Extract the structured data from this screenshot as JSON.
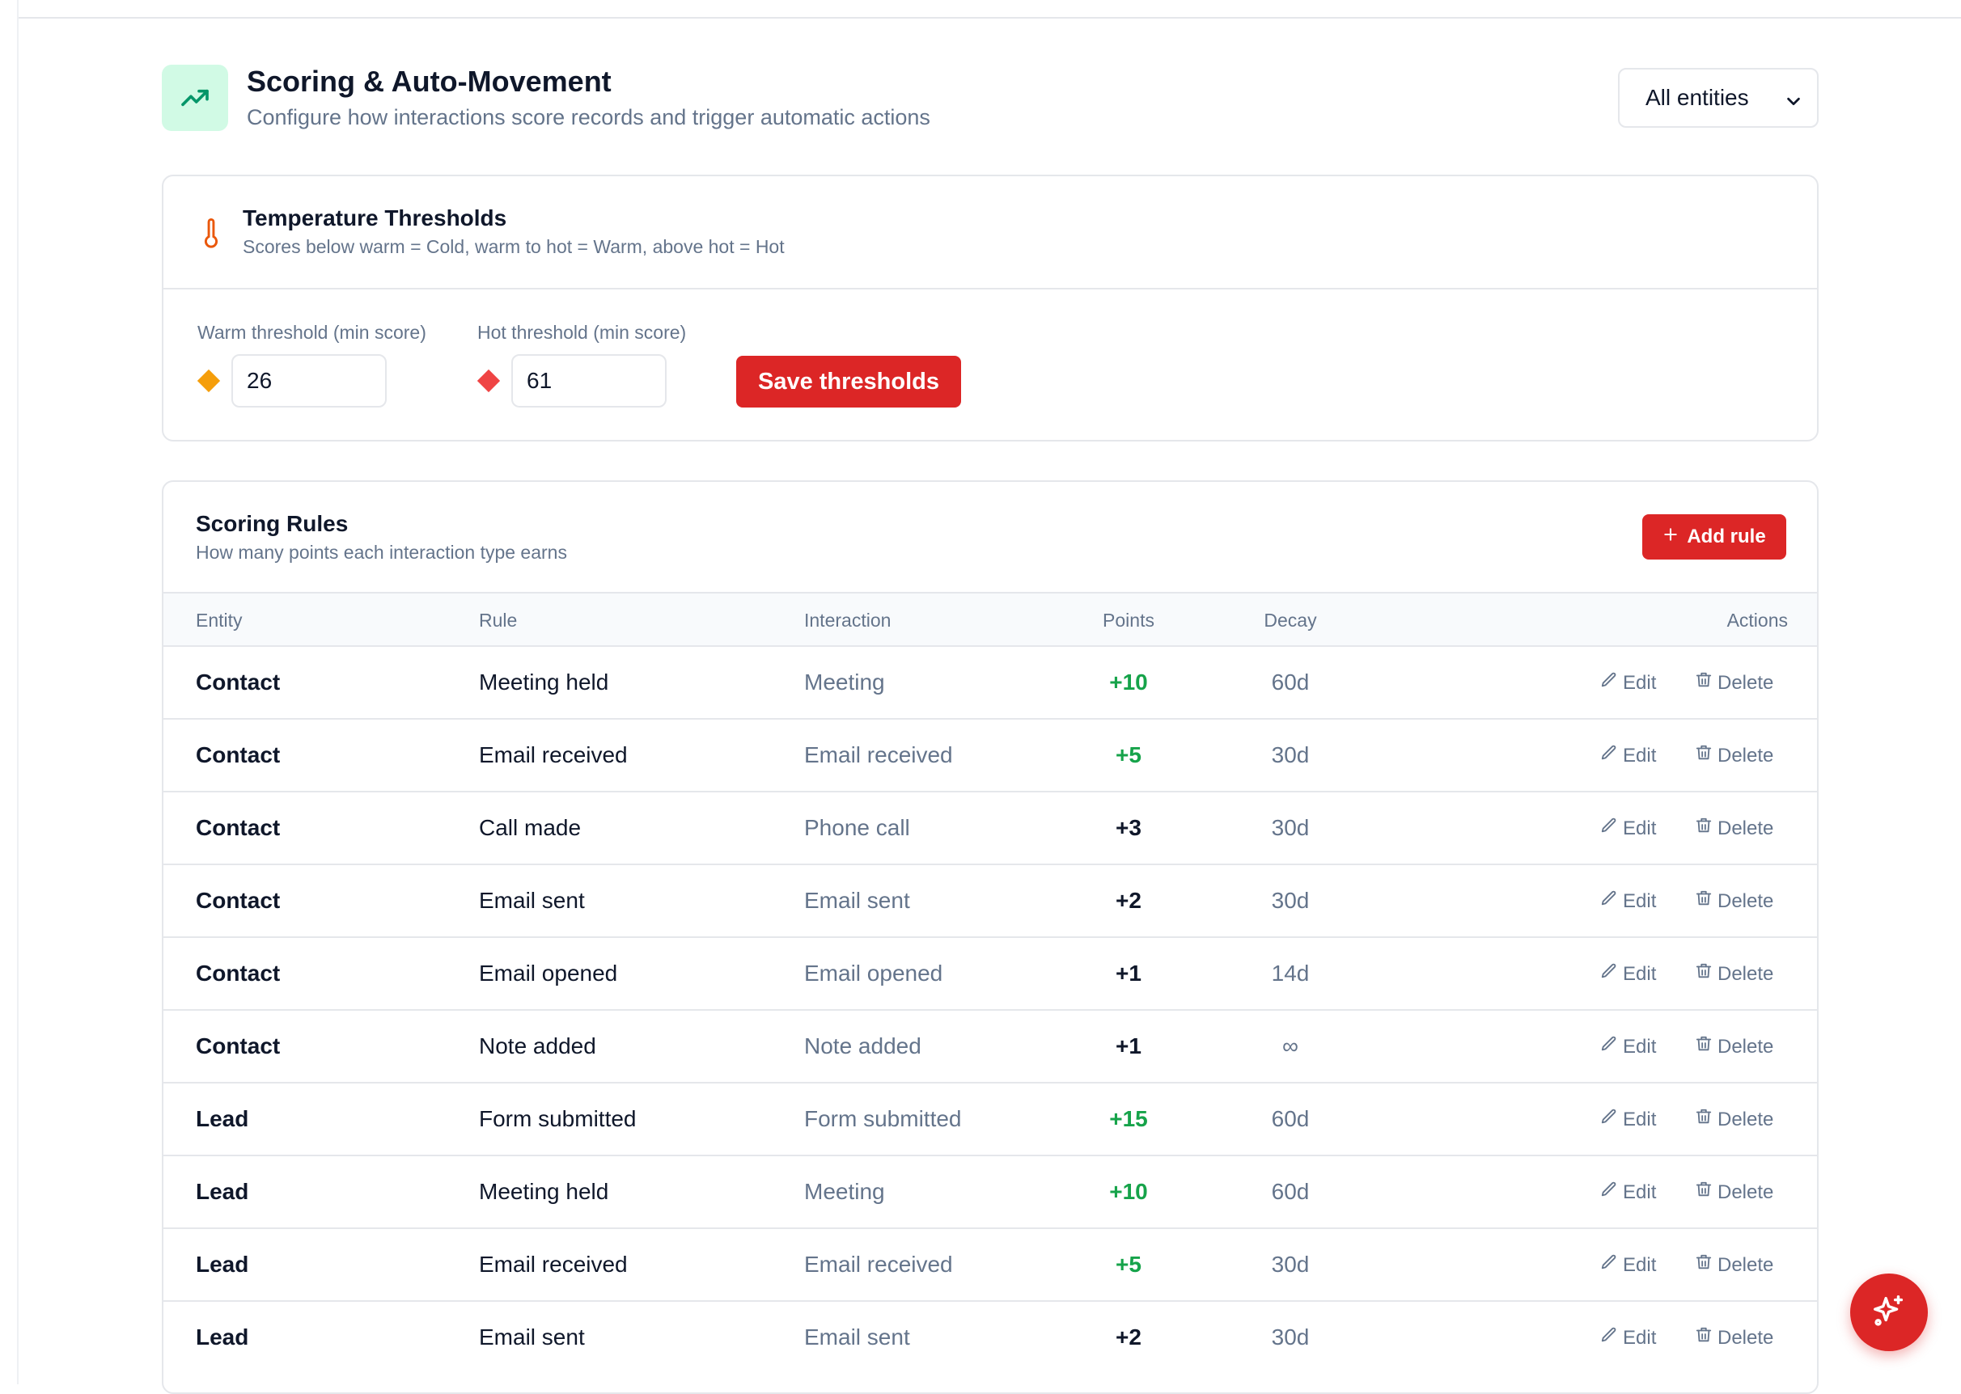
{
  "header": {
    "icon": "trending-up-icon",
    "title": "Scoring & Auto-Movement",
    "subtitle": "Configure how interactions score records and trigger automatic actions",
    "entity_filter": {
      "selected": "All entities"
    }
  },
  "thresholds": {
    "icon": "thermometer-icon",
    "title": "Temperature Thresholds",
    "subtitle": "Scores below warm = Cold, warm to hot = Warm, above hot = Hot",
    "warm": {
      "label": "Warm threshold (min score)",
      "value": "26",
      "color": "#f59e0b"
    },
    "hot": {
      "label": "Hot threshold (min score)",
      "value": "61",
      "color": "#ef4444"
    },
    "save_label": "Save thresholds"
  },
  "rules": {
    "title": "Scoring Rules",
    "subtitle": "How many points each interaction type earns",
    "add_label": "Add rule",
    "columns": [
      "Entity",
      "Rule",
      "Interaction",
      "Points",
      "Decay",
      "Actions"
    ],
    "edit_label": "Edit",
    "delete_label": "Delete",
    "rows": [
      {
        "entity": "Contact",
        "rule": "Meeting held",
        "interaction": "Meeting",
        "points": "+10",
        "decay": "60d",
        "highlight": true
      },
      {
        "entity": "Contact",
        "rule": "Email received",
        "interaction": "Email received",
        "points": "+5",
        "decay": "30d",
        "highlight": true
      },
      {
        "entity": "Contact",
        "rule": "Call made",
        "interaction": "Phone call",
        "points": "+3",
        "decay": "30d",
        "highlight": false
      },
      {
        "entity": "Contact",
        "rule": "Email sent",
        "interaction": "Email sent",
        "points": "+2",
        "decay": "30d",
        "highlight": false
      },
      {
        "entity": "Contact",
        "rule": "Email opened",
        "interaction": "Email opened",
        "points": "+1",
        "decay": "14d",
        "highlight": false
      },
      {
        "entity": "Contact",
        "rule": "Note added",
        "interaction": "Note added",
        "points": "+1",
        "decay": "∞",
        "highlight": false
      },
      {
        "entity": "Lead",
        "rule": "Form submitted",
        "interaction": "Form submitted",
        "points": "+15",
        "decay": "60d",
        "highlight": true
      },
      {
        "entity": "Lead",
        "rule": "Meeting held",
        "interaction": "Meeting",
        "points": "+10",
        "decay": "60d",
        "highlight": true
      },
      {
        "entity": "Lead",
        "rule": "Email received",
        "interaction": "Email received",
        "points": "+5",
        "decay": "30d",
        "highlight": true
      },
      {
        "entity": "Lead",
        "rule": "Email sent",
        "interaction": "Email sent",
        "points": "+2",
        "decay": "30d",
        "highlight": false
      }
    ]
  },
  "colors": {
    "accent": "#dc2626",
    "positive": "#16a34a",
    "muted": "#64748b"
  },
  "fab": {
    "icon": "sparkles-icon"
  }
}
